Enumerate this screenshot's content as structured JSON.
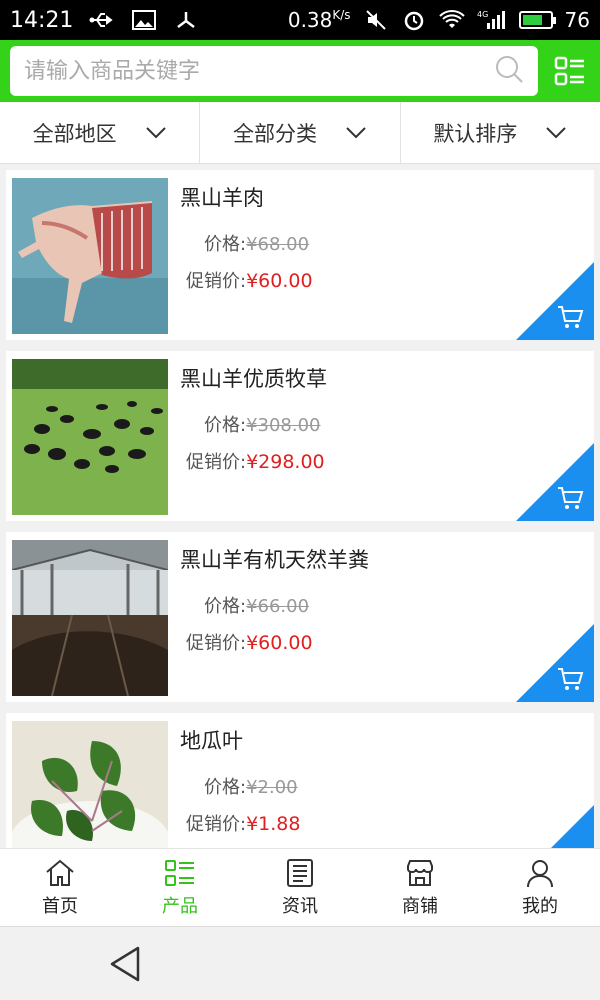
{
  "status_bar": {
    "time": "14:21",
    "network_speed": "0.38",
    "network_unit": "K/s",
    "signal_label": "4G",
    "battery_level": "76"
  },
  "search": {
    "placeholder": "请输入商品关键字"
  },
  "filters": [
    {
      "label": "全部地区"
    },
    {
      "label": "全部分类"
    },
    {
      "label": "默认排序"
    }
  ],
  "products": [
    {
      "name": "黑山羊肉",
      "price_label": "价格:",
      "price": "¥68.00",
      "sale_label": "促销价:",
      "sale_price": "¥60.00"
    },
    {
      "name": "黑山羊优质牧草",
      "price_label": "价格:",
      "price": "¥308.00",
      "sale_label": "促销价:",
      "sale_price": "¥298.00"
    },
    {
      "name": "黑山羊有机天然羊粪",
      "price_label": "价格:",
      "price": "¥66.00",
      "sale_label": "促销价:",
      "sale_price": "¥60.00"
    },
    {
      "name": "地瓜叶",
      "price_label": "价格:",
      "price": "¥2.00",
      "sale_label": "促销价:",
      "sale_price": "¥1.88"
    }
  ],
  "tabbar": [
    {
      "label": "首页",
      "icon": "home-icon"
    },
    {
      "label": "产品",
      "icon": "product-list-icon",
      "active": true
    },
    {
      "label": "资讯",
      "icon": "news-icon"
    },
    {
      "label": "商铺",
      "icon": "shop-icon"
    },
    {
      "label": "我的",
      "icon": "user-icon"
    }
  ],
  "colors": {
    "brand_green": "#35d21a",
    "active_green": "#35c21a",
    "sale_red": "#e02020",
    "cart_blue": "#1a8ff0"
  }
}
